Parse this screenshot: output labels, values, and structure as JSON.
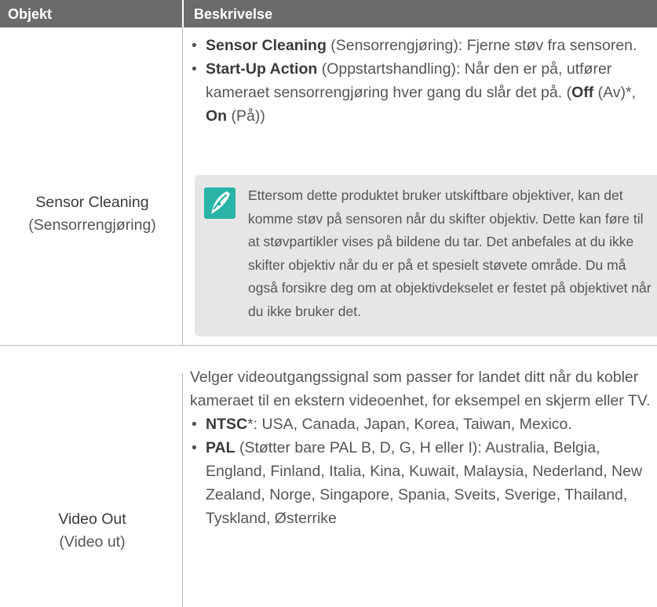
{
  "header": {
    "col_object": "Objekt",
    "col_description": "Beskrivelse"
  },
  "rows": [
    {
      "object": "Sensor Cleaning",
      "object_translation": "(Sensorrengjøring)",
      "bullets": [
        {
          "term": "Sensor Cleaning",
          "text": " (Sensorrengjøring): Fjerne støv fra sensoren."
        },
        {
          "term": "Start-Up Action",
          "text": " (Oppstartshandling): Når den er på, utfører kameraet sensorrengjøring hver gang du slår det på. (",
          "opt1": "Off",
          "opt1_text": " (Av)*, ",
          "opt2": "On",
          "opt2_text": " (På))"
        }
      ],
      "note": {
        "icon": "note-pen-icon",
        "text": "Ettersom dette produktet bruker utskiftbare objektiver, kan det komme støv på sensoren når du skifter objektiv. Dette kan føre til at støvpartikler vises på bildene du tar. Det anbefales at du ikke skifter objektiv når du er på et spesielt støvete område. Du må også forsikre deg om at objektivdekselet er festet på objektivet når du ikke bruker det."
      }
    },
    {
      "object": "Video Out",
      "object_translation": "(Video ut)",
      "intro": "Velger videoutgangssignal som passer for landet ditt når du kobler kameraet til en ekstern videoenhet, for eksempel en skjerm eller TV.",
      "bullets": [
        {
          "term": "NTSC",
          "text": "*: USA, Canada, Japan, Korea, Taiwan, Mexico."
        },
        {
          "term": "PAL",
          "text": " (Støtter bare PAL B, D, G, H eller I): Australia, Belgia, England, Finland, Italia, Kina, Kuwait, Malaysia, Nederland, New Zealand, Norge, Singapore, Spania, Sveits, Sverige, Thailand, Tyskland, Østerrike"
        }
      ]
    }
  ],
  "colors": {
    "header_bg": "#6b6b6b",
    "note_bg": "#e6e6e6",
    "icon_bg": "#2ab4a8"
  }
}
